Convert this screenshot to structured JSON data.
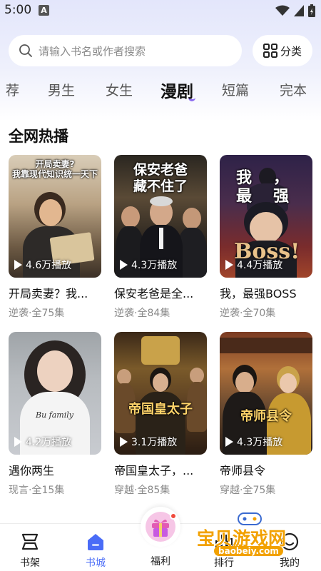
{
  "status_bar": {
    "time": "5:00",
    "notif_letter": "A"
  },
  "search": {
    "placeholder": "请输入书名或作者搜索",
    "category_label": "分类"
  },
  "tabs": [
    {
      "label": "荐",
      "active": false
    },
    {
      "label": "男生",
      "active": false
    },
    {
      "label": "女生",
      "active": false
    },
    {
      "label": "漫剧",
      "active": true
    },
    {
      "label": "短篇",
      "active": false
    },
    {
      "label": "完本",
      "active": false
    }
  ],
  "section_title": "全网热播",
  "cards": [
    {
      "cover_text": "开局卖妻?\n我靠现代知识统一天下",
      "plays": "4.6万播放",
      "title": "开局卖妻？我...",
      "meta": "逆袭·全75集"
    },
    {
      "cover_text": "保安老爸\n藏不住了",
      "plays": "4.3万播放",
      "title": "保安老爸是全...",
      "meta": "逆袭·全84集"
    },
    {
      "cover_text": "我，最强",
      "plays": "4.4万播放",
      "title": "我，最强BOSS",
      "meta": "逆袭·全70集"
    },
    {
      "cover_text": "",
      "plays": "4.2万播放",
      "title": "遇你两生",
      "meta": "现言·全15集"
    },
    {
      "cover_text": "帝国皇太子",
      "plays": "3.1万播放",
      "title": "帝国皇太子，...",
      "meta": "穿越·全85集"
    },
    {
      "cover_text": "帝师县令",
      "plays": "4.3万播放",
      "title": "帝师县令",
      "meta": "穿越·全75集"
    }
  ],
  "bottom_nav": [
    {
      "label": "书架",
      "icon": "bookshelf-icon",
      "active": false
    },
    {
      "label": "书城",
      "icon": "home-icon",
      "active": true
    },
    {
      "label": "福利",
      "icon": "gift-icon",
      "active": false
    },
    {
      "label": "排行",
      "icon": "ranking-icon",
      "active": false
    },
    {
      "label": "我的",
      "icon": "profile-icon",
      "active": false
    }
  ],
  "watermark": {
    "text": "宝贝游戏网",
    "url": "baobeiy.com"
  },
  "colors": {
    "accent": "#4a6cf7",
    "tab_underline": "#8c6cf0",
    "badge": "#f04a3c"
  }
}
